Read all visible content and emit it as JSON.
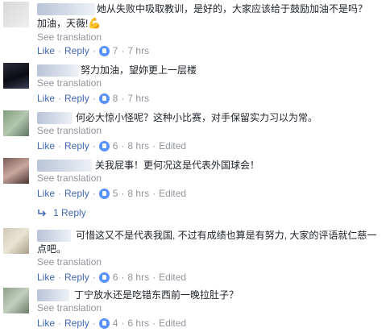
{
  "comments": [
    {
      "name": "…",
      "text_line1": "她从失败中吸取教训，是好的，大家应该给于鼓励加油不是吗？",
      "text_line2": "加油，天薇!",
      "emoji": "💪",
      "see_translation": "See translation",
      "like": "Like",
      "reply": "Reply",
      "dot": "·",
      "like_count": "7",
      "time": "7 hrs",
      "edited": ""
    },
    {
      "name": "",
      "text_line1": "努力加油，望妳更上一层楼",
      "see_translation": "See translation",
      "like": "Like",
      "reply": "Reply",
      "dot": "·",
      "like_count": "8",
      "time": "7 hrs",
      "edited": ""
    },
    {
      "name": "",
      "text_line1": "何必大惊小怪呢？这种小比赛，对手保留实力习以为常。",
      "see_translation": "See translation",
      "like": "Like",
      "reply": "Reply",
      "dot": "·",
      "like_count": "6",
      "time": "8 hrs",
      "edited": "Edited"
    },
    {
      "name": "",
      "text_line1": "关我屁事！更何况这是代表外国球会！",
      "see_translation": "See translation",
      "like": "Like",
      "reply": "Reply",
      "dot": "·",
      "like_count": "5",
      "time": "8 hrs",
      "edited": "Edited",
      "replies_label": "1 Reply"
    },
    {
      "name": "",
      "text_line1": "可惜这又不是代表我国, 不过有成绩也算是有努力, 大家的评语就仁慈一",
      "text_line2": "点吧。",
      "see_translation": "See translation",
      "like": "Like",
      "reply": "Reply",
      "dot": "·",
      "like_count": "6",
      "time": "8 hrs",
      "edited": "Edited"
    },
    {
      "name": "",
      "text_line1": "丁宁放水还是吃错东西前一晚拉肚子？",
      "see_translation": "See translation",
      "like": "Like",
      "reply": "Reply",
      "dot": "·",
      "like_count": "4",
      "time": "6 hrs",
      "edited": "Edited"
    }
  ],
  "icons": {
    "like_badge": "like-thumb-icon",
    "reply_arrow": "reply-arrow-icon"
  },
  "colors": {
    "link_blue": "#4267b2",
    "name_blue": "#385898",
    "meta_gray": "#90949c",
    "text": "#1d2129",
    "like_badge": "#5890ff"
  }
}
